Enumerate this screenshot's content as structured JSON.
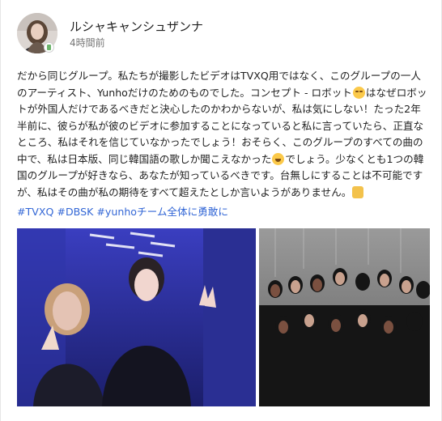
{
  "author": {
    "name": "ルシャキャンシュザンナ",
    "timestamp": "4時間前"
  },
  "post": {
    "body": "だから同じグループ。私たちが撮影したビデオはTVXQ用ではなく、このグループの一人のアーティスト、Yunhoだけのためのものでした。コンセプト - ロボット",
    "body_2": "はなぜロボットが外国人だけであるべきだと決心したのかわからないが、私は気にしない！たった2年半前に、彼らが私が彼のビデオに参加することになっていると私に言っていたら、正直なところ、私はそれを信じていなかったでしょう！おそらく、このグループのすべての曲の中で、私は日本版、同じ韓国語の歌しか聞こえなかった",
    "body_3": "でしょう。少なくとも1つの韓国のグループが好きなら、あなたが知っているべきです。台無しにすることは不可能ですが、私はその曲が私の期待をすべて超えたとしか言いようがありません。",
    "emoji_1": "face-with-tears-of-joy",
    "emoji_2": "grinning-face",
    "emoji_3": "clapping-hands"
  },
  "hashtags": [
    "#TVXQ",
    "#DBSK",
    "#yunho"
  ],
  "hashtags_tail": "チーム全体に勇敢に",
  "colors": {
    "link": "#3367d6",
    "photo_left_tone": "#3d3fb8",
    "photo_right_tone": "#7a7a7a"
  }
}
